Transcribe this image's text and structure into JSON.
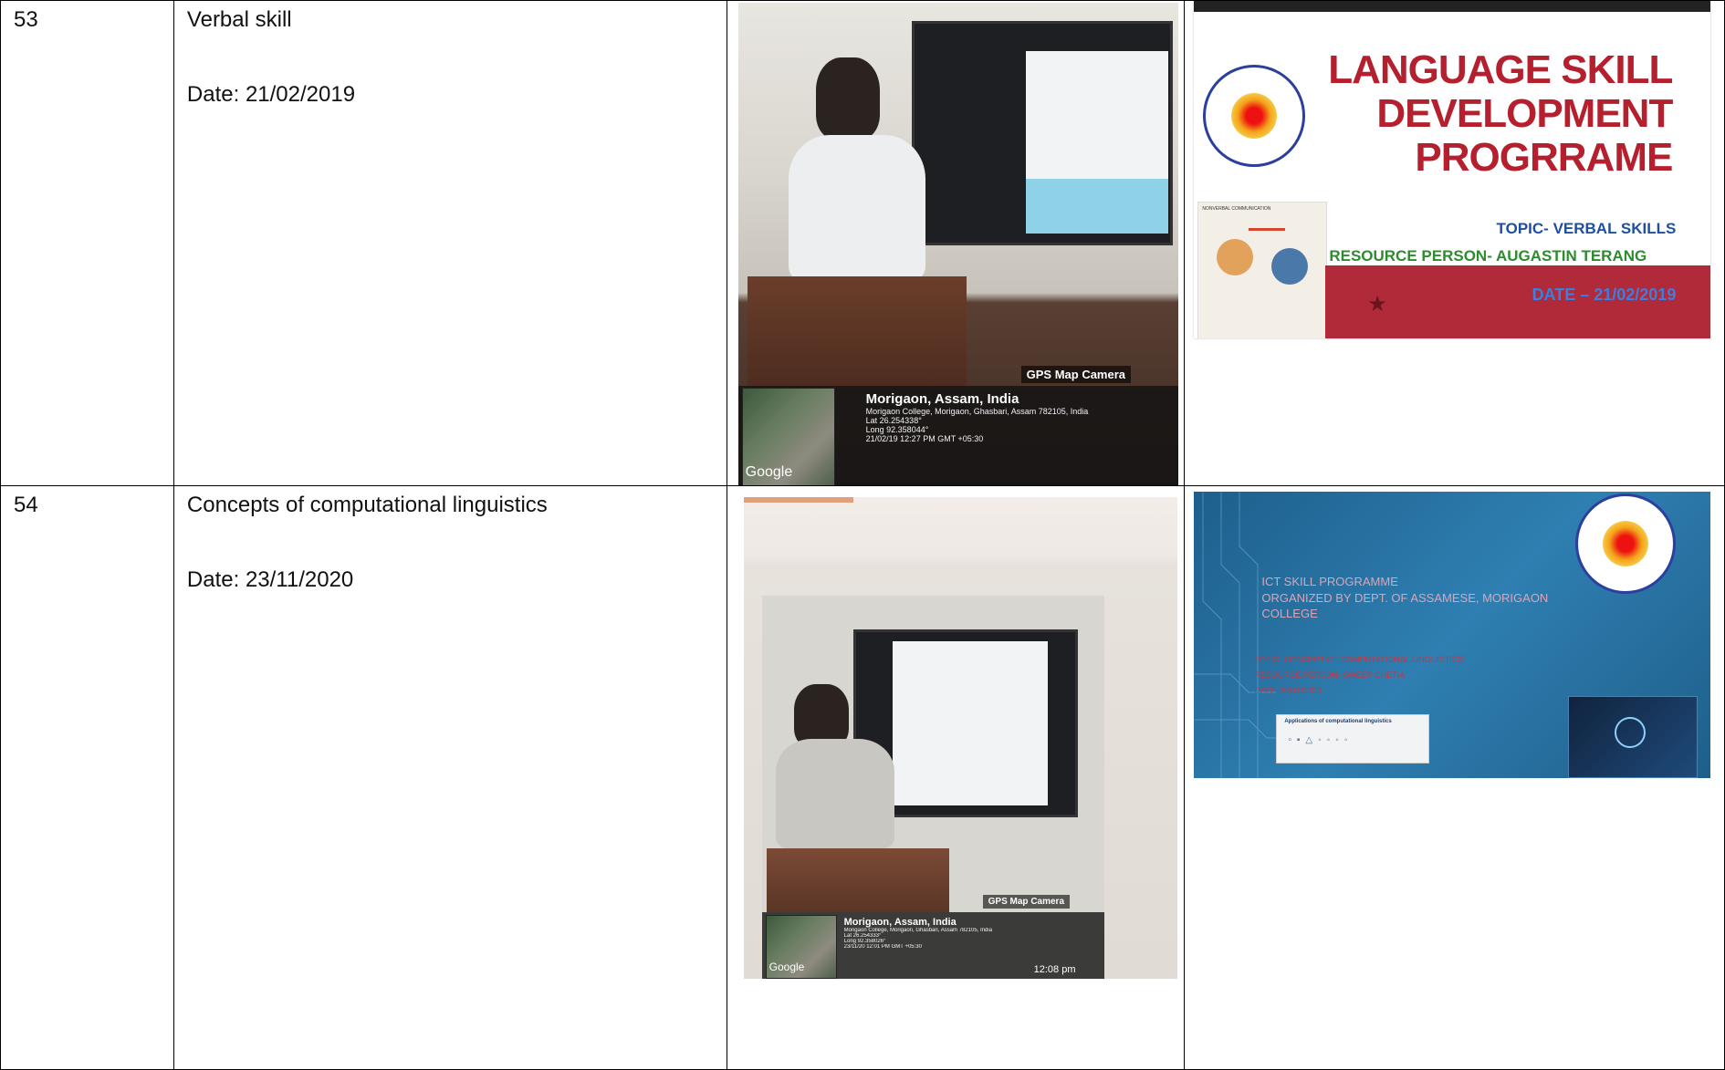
{
  "rows": [
    {
      "number": "53",
      "title": "Verbal skill",
      "date": "Date: 21/02/2019",
      "photo": {
        "gps_badge": "GPS Map Camera",
        "place": "Morigaon, Assam, India",
        "address": "Morigaon College, Morigaon, Ghasbari, Assam 782105, India",
        "lat": "Lat 26.254338°",
        "long": "Long 92.358044°",
        "timestamp": "21/02/19 12:27 PM GMT +05:30",
        "map_label": "Google"
      },
      "slide": {
        "title_lines": [
          "LANGUAGE SKILL",
          "DEVELOPMENT",
          "PROGRRAME"
        ],
        "topic": "TOPIC- VERBAL SKILLS",
        "resource": "RESOURCE PERSON- AUGASTIN TERANG",
        "date": "DATE – 21/02/2019",
        "image_caption": "NONVERBAL COMMUNICATION",
        "colors": {
          "title": "#b5202e",
          "topic": "#1e4fa3",
          "resource": "#2e8b2e",
          "band": "#b02a3a"
        }
      }
    },
    {
      "number": "54",
      "title": "Concepts of computational linguistics",
      "date": "Date: 23/11/2020",
      "photo": {
        "gps_badge": "GPS Map Camera",
        "place": "Morigaon, Assam, India",
        "address": "Morigaon College, Morigaon, Ghasbari, Assam 782105, India",
        "lat": "Lat 26.254333°",
        "long": "Long 92.358026°",
        "timestamp": "23/11/20 12:01 PM GMT +05:30",
        "time_badge": "12:08 pm",
        "map_label": "Google"
      },
      "slide": {
        "heading_lines": [
          "ICT SKILL PROGRAMME",
          "ORGANIZED BY DEPT. OF ASSAMESE, MORIGAON",
          "COLLEGE"
        ],
        "topic": "TOPIC- CONCEPT OF COMPUTATIONAL LINGUISTICS",
        "resource": "RESOURCE PERSON- SWEEP CHETIA",
        "date": "DATE- 23/11/2020",
        "inset_title": "Applications of computational linguistics",
        "colors": {
          "background": "#2a74a8",
          "heading": "#d9a6b6",
          "details": "#c53742"
        }
      }
    }
  ]
}
